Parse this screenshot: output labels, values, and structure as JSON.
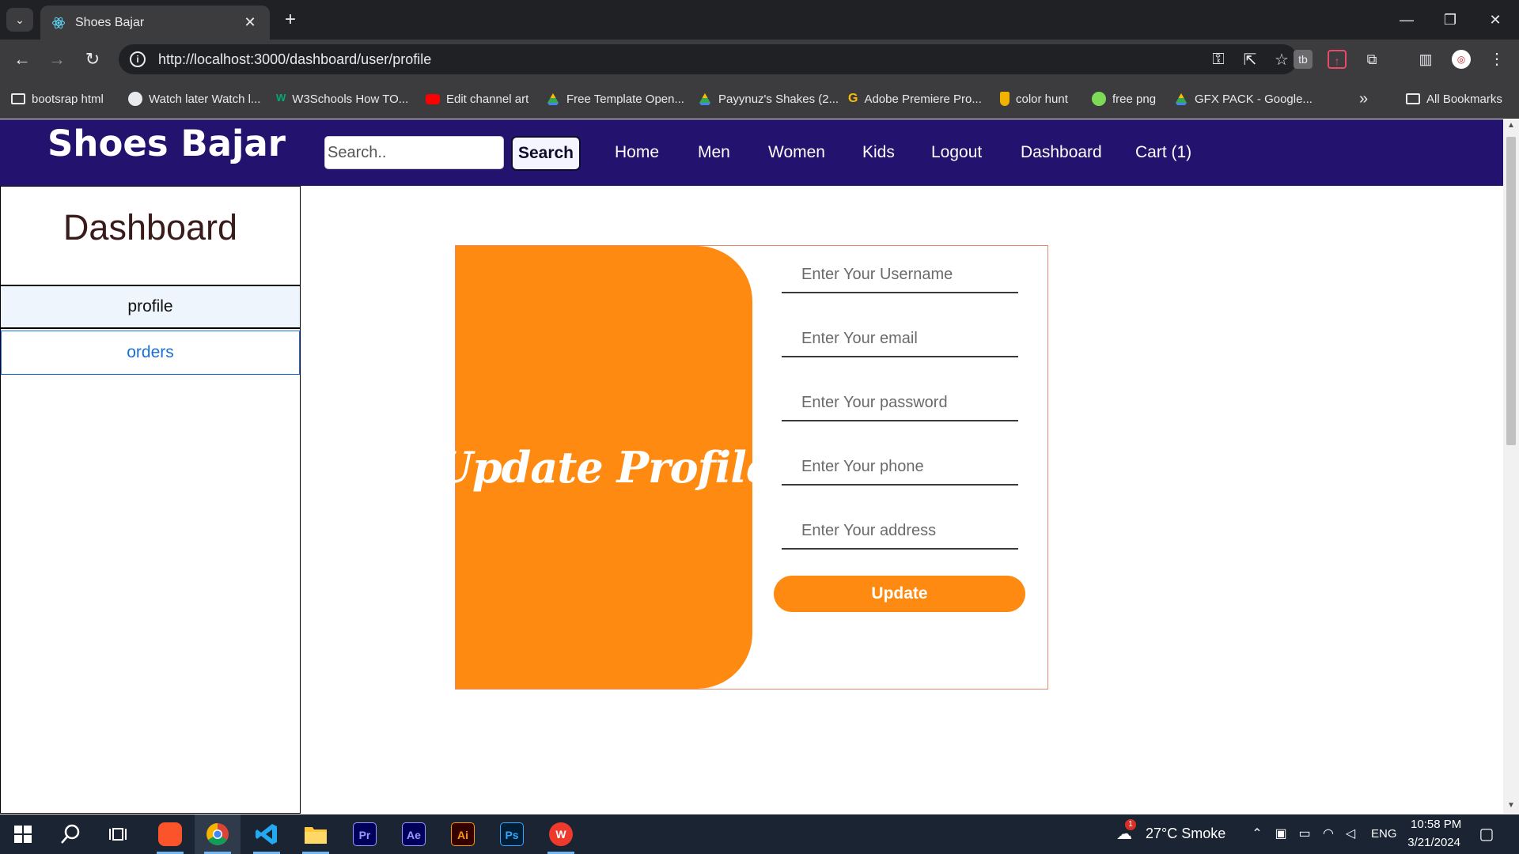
{
  "browser": {
    "tab_title": "Shoes Bajar",
    "tab_close": "✕",
    "new_tab": "+",
    "url": "http://localhost:3000/dashboard/user/profile",
    "window_controls": [
      "—",
      "❐",
      "✕"
    ],
    "bookmarks": [
      {
        "label": "bootsrap html",
        "icon": "folder-icon"
      },
      {
        "label": "Watch later Watch l...",
        "icon": "globe-icon"
      },
      {
        "label": "W3Schools How TO...",
        "icon": "w3schools-icon"
      },
      {
        "label": "Edit channel art",
        "icon": "youtube-icon"
      },
      {
        "label": "Free Template Open...",
        "icon": "google-drive-icon"
      },
      {
        "label": "Payynuz's Shakes (2...",
        "icon": "google-drive-icon"
      },
      {
        "label": "Adobe Premiere Pro...",
        "icon": "google-icon"
      },
      {
        "label": "color hunt",
        "icon": "colorhunt-icon"
      },
      {
        "label": "free png",
        "icon": "freepng-icon"
      },
      {
        "label": "GFX PACK - Google...",
        "icon": "google-drive-icon"
      }
    ],
    "bookmarks_overflow": "»",
    "all_bookmarks": "All Bookmarks"
  },
  "site": {
    "brand": "Shoes Bajar",
    "search_placeholder": "Search..",
    "search_button": "Search",
    "nav": [
      "Home",
      "Men",
      "Women",
      "Kids",
      "Logout",
      "Dashboard",
      "Cart (1)"
    ]
  },
  "sidebar": {
    "title": "Dashboard",
    "items": [
      "profile",
      "orders"
    ]
  },
  "form": {
    "banner": "Update Profile",
    "username_placeholder": "Enter Your Username",
    "email_placeholder": "Enter Your email",
    "password_placeholder": "Enter Your password",
    "phone_placeholder": "Enter Your phone",
    "address_placeholder": "Enter Your address",
    "submit": "Update"
  },
  "taskbar": {
    "apps": [
      {
        "name": "start",
        "label": ""
      },
      {
        "name": "search",
        "label": ""
      },
      {
        "name": "task-view",
        "label": ""
      },
      {
        "name": "brave",
        "label": ""
      },
      {
        "name": "chrome",
        "label": ""
      },
      {
        "name": "vscode",
        "label": ""
      },
      {
        "name": "file-explorer",
        "label": ""
      },
      {
        "name": "premiere",
        "label": "Pr"
      },
      {
        "name": "after-effects",
        "label": "Ae"
      },
      {
        "name": "illustrator",
        "label": "Ai"
      },
      {
        "name": "photoshop",
        "label": "Ps"
      },
      {
        "name": "wps",
        "label": "W"
      }
    ],
    "weather": "27°C  Smoke",
    "weather_badge": "1",
    "language": "ENG",
    "time": "10:58 PM",
    "date": "3/21/2024"
  },
  "colors": {
    "navbar": "#23126e",
    "accent": "#ff8a12",
    "sidebar_title": "#3a1b1b",
    "link": "#1d6fd8"
  }
}
